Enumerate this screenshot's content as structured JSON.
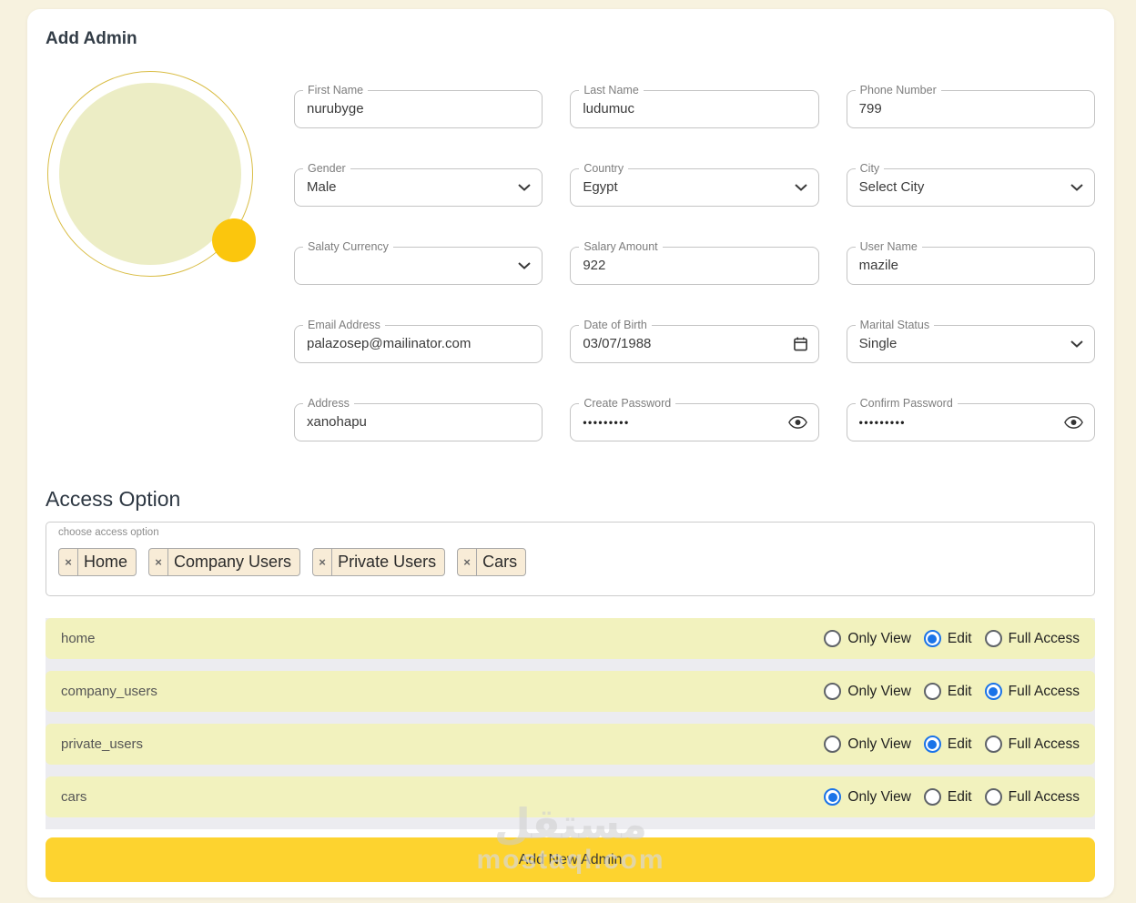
{
  "page": {
    "title": "Add Admin",
    "access_heading": "Access Option",
    "watermark_arabic": "مستقل",
    "watermark_latin": "mostaql.com"
  },
  "form": {
    "fields": [
      {
        "label": "First Name",
        "value": "nurubyge",
        "type": "text"
      },
      {
        "label": "Last Name",
        "value": "ludumuc",
        "type": "text"
      },
      {
        "label": "Phone Number",
        "value": "799",
        "type": "text"
      },
      {
        "label": "Gender",
        "value": "Male",
        "type": "select"
      },
      {
        "label": "Country",
        "value": "Egypt",
        "type": "select"
      },
      {
        "label": "City",
        "value": "Select City",
        "type": "select"
      },
      {
        "label": "Salaty Currency",
        "value": "",
        "type": "select"
      },
      {
        "label": "Salary Amount",
        "value": "922",
        "type": "text"
      },
      {
        "label": "User Name",
        "value": "mazile",
        "type": "text"
      },
      {
        "label": "Email Address",
        "value": "palazosep@mailinator.com",
        "type": "text"
      },
      {
        "label": "Date of Birth",
        "value": "03/07/1988",
        "type": "date"
      },
      {
        "label": "Marital Status",
        "value": "Single",
        "type": "select"
      },
      {
        "label": "Address",
        "value": "xanohapu",
        "type": "text"
      },
      {
        "label": "Create Password",
        "value": "•••••••••",
        "type": "password"
      },
      {
        "label": "Confirm Password",
        "value": "•••••••••",
        "type": "password"
      }
    ]
  },
  "access": {
    "picker_label": "choose access option",
    "remove_symbol": "×",
    "tags": [
      "Home",
      "Company Users",
      "Private Users",
      "Cars"
    ],
    "options": [
      "Only View",
      "Edit",
      "Full Access"
    ],
    "rows": [
      {
        "name": "home",
        "selected": "Edit"
      },
      {
        "name": "company_users",
        "selected": "Full Access"
      },
      {
        "name": "private_users",
        "selected": "Edit"
      },
      {
        "name": "cars",
        "selected": "Only View"
      }
    ]
  },
  "submit_label": "Add New Admin",
  "colors": {
    "page_bg": "#f7f2df",
    "card_bg": "#ffffff",
    "button_yellow": "#fdd32f",
    "row_bg": "#f2f2be",
    "tag_bg": "#f8ecd7",
    "radio_checked_blue": "#1a73e8",
    "avatar_fill": "#ecedc5",
    "avatar_ring": "#d9bd45",
    "avatar_dot": "#fbc60d",
    "field_border": "#c4c4c4",
    "label_gray": "#7d7d7d"
  }
}
